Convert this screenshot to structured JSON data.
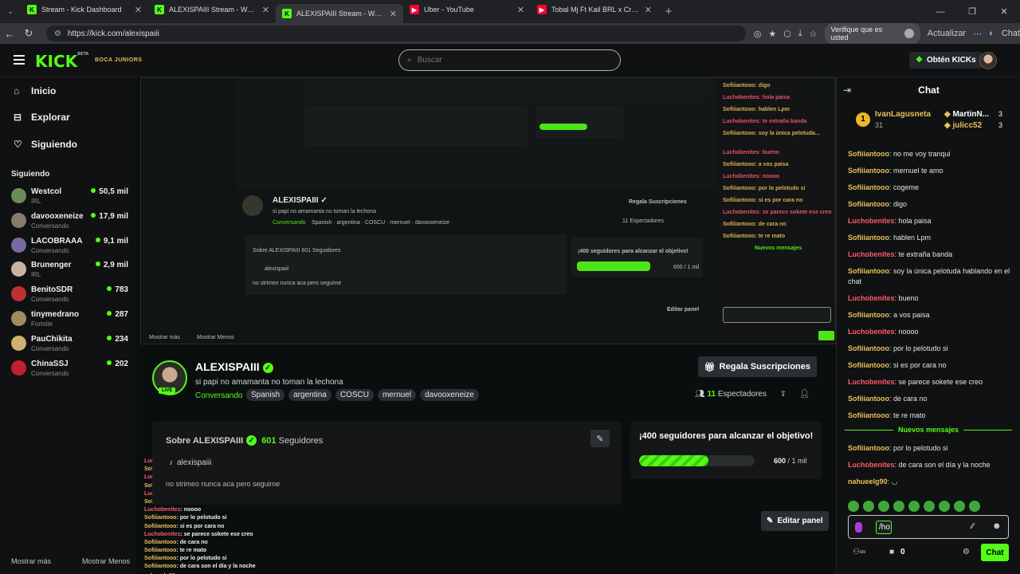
{
  "browser": {
    "tabs": [
      {
        "title": "Stream - Kick Dashboard",
        "icon": "kick-icon"
      },
      {
        "title": "ALEXISPAIII Stream - Watch Live o",
        "icon": "kick-icon"
      },
      {
        "title": "ALEXISPAIII Stream - Watch Live o",
        "icon": "kick-icon",
        "active": true
      },
      {
        "title": "Uber - YouTube",
        "icon": "youtube-icon"
      },
      {
        "title": "Tobal Mj Ft Kail BRL x Cris MJ \"QU",
        "icon": "youtube-icon"
      }
    ],
    "url": "https://kick.com/alexispaiii",
    "verify_label": "Verifique que es usted",
    "update_label": "Actualizar",
    "chat_label": "Chat"
  },
  "header": {
    "logo": "KICK",
    "logo_beta": "BETA",
    "brand_tag": "BOCA JUNIORS",
    "search_placeholder": "Buscar",
    "kicks_button": "Obtén KICKs"
  },
  "sidebar": {
    "nav": [
      {
        "label": "Inicio",
        "icon": "home-icon"
      },
      {
        "label": "Explorar",
        "icon": "compass-icon"
      },
      {
        "label": "Siguiendo",
        "icon": "heart-icon"
      }
    ],
    "following_heading": "Siguiendo",
    "channels": [
      {
        "name": "Westcol",
        "category": "IRL",
        "viewers": "50,5 mil",
        "color": "#6b8c5a"
      },
      {
        "name": "davooxeneize",
        "category": "Conversando",
        "viewers": "17,9 mil",
        "color": "#8a7a6a"
      },
      {
        "name": "LACOBRAAA",
        "category": "Conversando",
        "viewers": "9,1 mil",
        "color": "#7a6aa0"
      },
      {
        "name": "Brunenger",
        "category": "IRL",
        "viewers": "2,9 mil",
        "color": "#c9b3a0"
      },
      {
        "name": "BenitoSDR",
        "category": "Conversando",
        "viewers": "783",
        "color": "#c03030"
      },
      {
        "name": "tinymedrano",
        "category": "Fortnite",
        "viewers": "287",
        "color": "#a08a60"
      },
      {
        "name": "PauChikita",
        "category": "Conversando",
        "viewers": "234",
        "color": "#d2b070"
      },
      {
        "name": "ChinaSSJ",
        "category": "Conversando",
        "viewers": "202",
        "color": "#c02030"
      }
    ],
    "show_more": "Mostrar más",
    "show_less": "Mostrar Menos"
  },
  "channel": {
    "name": "ALEXISPAIII",
    "title": "si papi no amamanta no toman la lechona",
    "category": "Conversando",
    "tags": [
      "Spanish",
      "argentina",
      "COSCU",
      "mernuel",
      "davooxeneize"
    ],
    "live": "LIVE",
    "subscribe": "Regala Suscripciones",
    "viewers_count": "11",
    "viewers_label": "Espectadores",
    "about_title": "Sobre ALEXISPAIII",
    "followers_count": "601",
    "followers_label": "Seguidores",
    "tiktok": "alexispaiii",
    "about_desc": "no strimeo nunca aca pero seguime",
    "goal_title": "¡400 seguidores para alcanzar el objetivo!",
    "goal_count": "600",
    "goal_total": "/ 1 mil",
    "goal_progress": 0.6,
    "edit_panel": "Editar panel"
  },
  "overlay_chat": [
    {
      "user": "Luchobenites",
      "text": ": hola paisa",
      "red": true
    },
    {
      "user": "Sofiiiantooo",
      "text": ": hablen Lpm"
    },
    {
      "user": "Luchobenites",
      "text": ": te extraño banda",
      "red": true
    },
    {
      "user": "Sofiiiantooo",
      "text": ": soy la única pelotuda hablando en el chat"
    },
    {
      "user": "Luchobenites",
      "text": ": bueno",
      "red": true
    },
    {
      "user": "Sofiiiantooo",
      "text": ": a vos paisa"
    },
    {
      "user": "Luchobenites",
      "text": ": noooo",
      "red": true
    },
    {
      "user": "Sofiiiantooo",
      "text": ": por lo pelotudo si"
    },
    {
      "user": "Sofiiiantooo",
      "text": ": si es por cara no"
    },
    {
      "user": "Luchobenites",
      "text": ": se parece sokete ese creo",
      "red": true
    },
    {
      "user": "Sofiiiantooo",
      "text": ": de cara no"
    },
    {
      "user": "Sofiiiantooo",
      "text": ": te re mato"
    },
    {
      "user": "Sofiiiantooo",
      "text": ": por lo pelotudo si"
    },
    {
      "user": "Sofiiiantooo",
      "text": ": de cara son el día y la noche"
    },
    {
      "user": "nahueelg90",
      "text": ": ◡"
    }
  ],
  "chat": {
    "title": "Chat",
    "gifters": [
      {
        "name": "IvanLagusneta",
        "count": "31"
      },
      {
        "name": "MartinN...",
        "count": "3"
      },
      {
        "name": "julicc52",
        "count": "3"
      }
    ],
    "messages": [
      {
        "user": "Sofiiiantooo",
        "text": "no me voy tranqui"
      },
      {
        "user": "Sofiiiantooo",
        "text": "mernuel te amo"
      },
      {
        "user": "Sofiiiantooo",
        "text": "cogeme"
      },
      {
        "user": "Sofiiiantooo",
        "text": "digo"
      },
      {
        "user": "Luchobenites",
        "text": "hola paisa",
        "red": true
      },
      {
        "user": "Sofiiiantooo",
        "text": "hablen Lpm"
      },
      {
        "user": "Luchobenites",
        "text": "te extraña banda",
        "red": true
      },
      {
        "user": "Sofiiiantooo",
        "text": "soy la única pelotuda hablando en el chat"
      },
      {
        "user": "Luchobenites",
        "text": "bueno",
        "red": true
      },
      {
        "user": "Sofiiiantooo",
        "text": "a vos paisa"
      },
      {
        "user": "Luchobenites",
        "text": "noooo",
        "red": true
      },
      {
        "user": "Sofiiiantooo",
        "text": "por lo pelotudo si"
      },
      {
        "user": "Sofiiiantooo",
        "text": "si es por cara no"
      },
      {
        "user": "Luchobenites",
        "text": "se parece sokete ese creo",
        "red": true
      },
      {
        "user": "Sofiiiantooo",
        "text": "de cara no"
      },
      {
        "user": "Sofiiiantooo",
        "text": "te re mato"
      }
    ],
    "new_messages": "Nuevos mensajes",
    "messages_after": [
      {
        "user": "Sofiiiantooo",
        "text": "por lo pelotudo si"
      },
      {
        "user": "Luchobenites",
        "text": "de cara son el día y la noche",
        "red": true
      },
      {
        "user": "nahueelg90",
        "text": "◡"
      }
    ],
    "input_value": "/ho",
    "send": "Chat",
    "points": "0",
    "colors": {
      "accent": "#53fc18",
      "username": "#e9c05a",
      "username_alt": "#ff5a6e"
    }
  }
}
